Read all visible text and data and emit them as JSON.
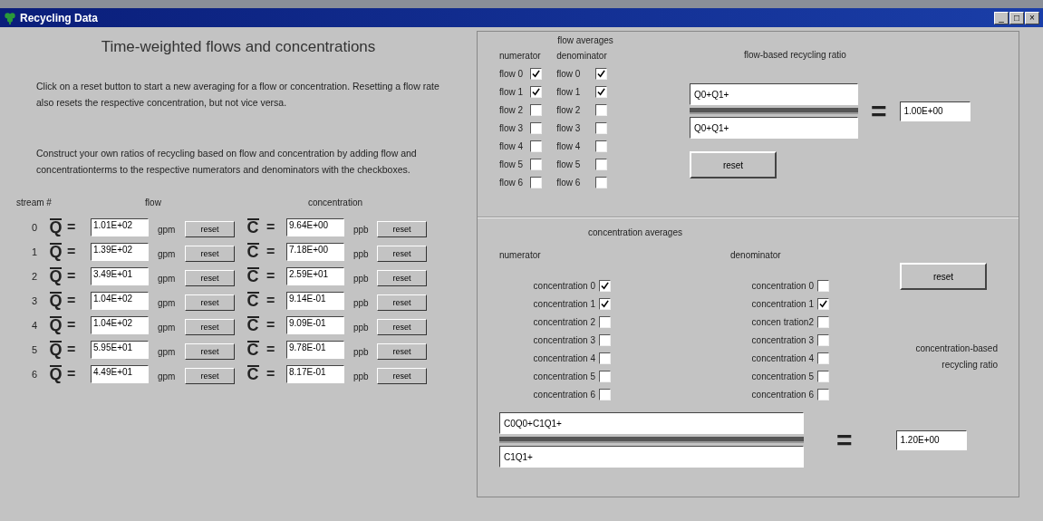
{
  "window": {
    "title": "Recycling Data",
    "controls": [
      "_",
      "□",
      "×"
    ]
  },
  "left": {
    "heading": "Time-weighted flows and concentrations",
    "paragraphs": [
      "Click on a reset button to start a new averaging for a flow or concentration. Resetting a flow rate also resets the respective concentration, but not vice versa.",
      "Construct your own ratios of recycling based on flow and concentration by adding flow and concentrationterms to the respective numerators and denominators with the checkboxes."
    ],
    "columns": [
      "stream #",
      "flow",
      "concentration"
    ],
    "streams": [
      {
        "index": "0",
        "flow_symbol": "Q",
        "flow_eq": "=",
        "flow": "1.01E+02",
        "flow_unit": "gpm",
        "flow_reset": "reset",
        "conc_symbol": "C",
        "conc_eq": "=",
        "conc": "9.64E+00",
        "conc_unit": "ppb",
        "conc_reset": "reset"
      },
      {
        "index": "1",
        "flow_symbol": "Q",
        "flow_eq": "=",
        "flow": "1.39E+02",
        "flow_unit": "gpm",
        "flow_reset": "reset",
        "conc_symbol": "C",
        "conc_eq": "=",
        "conc": "7.18E+00",
        "conc_unit": "ppb",
        "conc_reset": "reset"
      },
      {
        "index": "2",
        "flow_symbol": "Q",
        "flow_eq": "=",
        "flow": "3.49E+01",
        "flow_unit": "gpm",
        "flow_reset": "reset",
        "conc_symbol": "C",
        "conc_eq": "=",
        "conc": "2.59E+01",
        "conc_unit": "ppb",
        "conc_reset": "reset"
      },
      {
        "index": "3",
        "flow_symbol": "Q",
        "flow_eq": "=",
        "flow": "1.04E+02",
        "flow_unit": "gpm",
        "flow_reset": "reset",
        "conc_symbol": "C",
        "conc_eq": "=",
        "conc": "9.14E-01",
        "conc_unit": "ppb",
        "conc_reset": "reset"
      },
      {
        "index": "4",
        "flow_symbol": "Q",
        "flow_eq": "=",
        "flow": "1.04E+02",
        "flow_unit": "gpm",
        "flow_reset": "reset",
        "conc_symbol": "C",
        "conc_eq": "=",
        "conc": "9.09E-01",
        "conc_unit": "ppb",
        "conc_reset": "reset"
      },
      {
        "index": "5",
        "flow_symbol": "Q",
        "flow_eq": "=",
        "flow": "5.95E+01",
        "flow_unit": "gpm",
        "flow_reset": "reset",
        "conc_symbol": "C",
        "conc_eq": "=",
        "conc": "9.78E-01",
        "conc_unit": "ppb",
        "conc_reset": "reset"
      },
      {
        "index": "6",
        "flow_symbol": "Q",
        "flow_eq": "=",
        "flow": "4.49E+01",
        "flow_unit": "gpm",
        "flow_reset": "reset",
        "conc_symbol": "C",
        "conc_eq": "=",
        "conc": "8.17E-01",
        "conc_unit": "ppb",
        "conc_reset": "reset"
      }
    ]
  },
  "flow_averages": {
    "title": "flow averages",
    "numerator_label": "numerator",
    "denominator_label": "denominator",
    "numerator": [
      {
        "label": "flow 0",
        "checked": true
      },
      {
        "label": "flow 1",
        "checked": true
      },
      {
        "label": "flow 2",
        "checked": false
      },
      {
        "label": "flow 3",
        "checked": false
      },
      {
        "label": "flow 4",
        "checked": false
      },
      {
        "label": "flow 5",
        "checked": false
      },
      {
        "label": "flow 6",
        "checked": false
      }
    ],
    "denominator": [
      {
        "label": "flow 0",
        "checked": true
      },
      {
        "label": "flow 1",
        "checked": true
      },
      {
        "label": "flow 2",
        "checked": false
      },
      {
        "label": "flow 3",
        "checked": false
      },
      {
        "label": "flow 4",
        "checked": false
      },
      {
        "label": "flow 5",
        "checked": false
      },
      {
        "label": "flow 6",
        "checked": false
      }
    ],
    "ratio_title": "flow-based recycling ratio",
    "numerator_value": "Q0+Q1+",
    "denominator_value": "Q0+Q1+",
    "equals": "=",
    "ratio": "1.00E+00",
    "reset": "reset"
  },
  "concentration_averages": {
    "title": "concentration averages",
    "numerator_label": "numerator",
    "denominator_label": "denominator",
    "numerator": [
      {
        "label": "concentration 0",
        "checked": true
      },
      {
        "label": "concentration 1",
        "checked": true
      },
      {
        "label": "concentration 2",
        "checked": false
      },
      {
        "label": "concentration 3",
        "checked": false
      },
      {
        "label": "concentration 4",
        "checked": false
      },
      {
        "label": "concentration 5",
        "checked": false
      },
      {
        "label": "concentration 6",
        "checked": false
      }
    ],
    "denominator": [
      {
        "label": "concentration 0",
        "checked": false
      },
      {
        "label": "concentration 1",
        "checked": true
      },
      {
        "label": "concen tration2",
        "checked": false
      },
      {
        "label": "concentration 3",
        "checked": false
      },
      {
        "label": "concentration 4",
        "checked": false
      },
      {
        "label": "concentration 5",
        "checked": false
      },
      {
        "label": "concentration 6",
        "checked": false
      }
    ],
    "reset": "reset",
    "ratio_title": "concentration-based recycling ratio",
    "numerator_value": "C0Q0+C1Q1+",
    "denominator_value": "C1Q1+",
    "equals": "=",
    "ratio": "1.20E+00"
  }
}
